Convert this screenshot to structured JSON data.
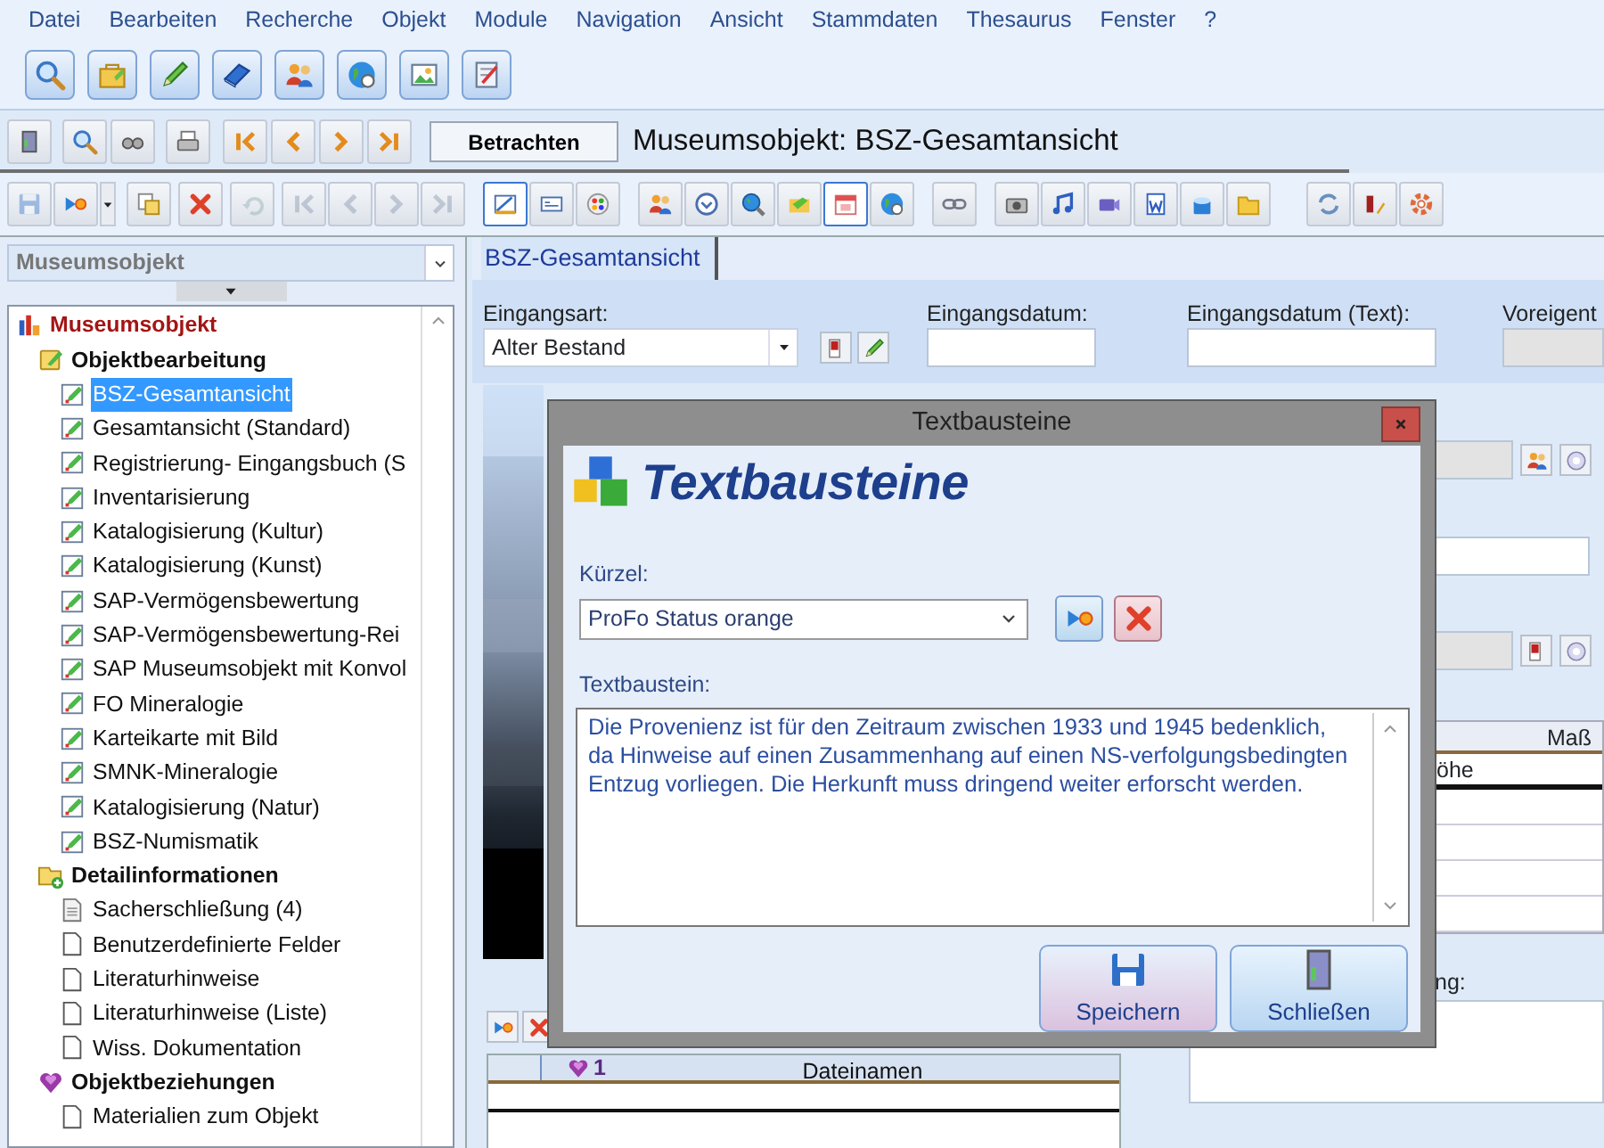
{
  "menu": [
    "Datei",
    "Bearbeiten",
    "Recherche",
    "Objekt",
    "Module",
    "Navigation",
    "Ansicht",
    "Stammdaten",
    "Thesaurus",
    "Fenster",
    "?"
  ],
  "record_bar": {
    "view_button": "Betrachten",
    "title": "Museumsobjekt: BSZ-Gesamtansicht"
  },
  "edit_toolbar": [
    {
      "on": false,
      "disabled": true
    },
    {
      "on": false,
      "disabled": false
    },
    {
      "on": false,
      "disabled": false
    },
    {
      "on": false,
      "disabled": false
    },
    {
      "on": false,
      "disabled": true
    },
    {
      "on": false,
      "disabled": true
    },
    {
      "on": false,
      "disabled": true
    },
    {
      "on": false,
      "disabled": true
    },
    {
      "on": false,
      "disabled": true
    },
    {
      "on": true,
      "disabled": false
    },
    {
      "on": false,
      "disabled": false
    },
    {
      "on": false,
      "disabled": false
    },
    {
      "on": false,
      "disabled": false
    },
    {
      "on": false,
      "disabled": false
    },
    {
      "on": false,
      "disabled": false
    },
    {
      "on": false,
      "disabled": false
    },
    {
      "on": true,
      "disabled": false
    },
    {
      "on": false,
      "disabled": false
    },
    {
      "on": false,
      "disabled": false
    },
    {
      "on": false,
      "disabled": false
    },
    {
      "on": false,
      "disabled": false
    },
    {
      "on": false,
      "disabled": false
    },
    {
      "on": false,
      "disabled": false
    },
    {
      "on": false,
      "disabled": false
    },
    {
      "on": false,
      "disabled": false
    },
    {
      "on": false,
      "disabled": false
    },
    {
      "on": false,
      "disabled": false
    },
    {
      "on": false,
      "disabled": false
    }
  ],
  "navigator": {
    "selector": "Museumsobjekt",
    "tree": {
      "label": "Museumsobjekt",
      "kind": "root",
      "children": [
        {
          "label": "Objektbearbeitung",
          "kind": "group",
          "children": [
            {
              "label": "BSZ-Gesamtansicht",
              "kind": "form",
              "selected": true
            },
            {
              "label": "Gesamtansicht (Standard)",
              "kind": "form",
              "selected": false
            },
            {
              "label": "Registrierung- Eingangsbuch (S",
              "kind": "form",
              "selected": false
            },
            {
              "label": "Inventarisierung",
              "kind": "form",
              "selected": false
            },
            {
              "label": "Katalogisierung (Kultur)",
              "kind": "form",
              "selected": false
            },
            {
              "label": "Katalogisierung (Kunst)",
              "kind": "form",
              "selected": false
            },
            {
              "label": "SAP-Vermögensbewertung",
              "kind": "form",
              "selected": false
            },
            {
              "label": "SAP-Vermögensbewertung-Rei",
              "kind": "form",
              "selected": false
            },
            {
              "label": "SAP Museumsobjekt mit Konvol",
              "kind": "form",
              "selected": false
            },
            {
              "label": "FO Mineralogie",
              "kind": "form",
              "selected": false
            },
            {
              "label": "Karteikarte mit Bild",
              "kind": "form",
              "selected": false
            },
            {
              "label": "SMNK-Mineralogie",
              "kind": "form",
              "selected": false
            },
            {
              "label": "Katalogisierung (Natur)",
              "kind": "form",
              "selected": false
            },
            {
              "label": "BSZ-Numismatik",
              "kind": "form",
              "selected": false
            }
          ]
        },
        {
          "label": "Detailinformationen",
          "kind": "group",
          "children": [
            {
              "label": "Sacherschließung (4)",
              "kind": "list",
              "selected": false
            },
            {
              "label": "Benutzerdefinierte Felder",
              "kind": "page",
              "selected": false
            },
            {
              "label": "Literaturhinweise",
              "kind": "page",
              "selected": false
            },
            {
              "label": "Literaturhinweise (Liste)",
              "kind": "page",
              "selected": false
            },
            {
              "label": "Wiss. Dokumentation",
              "kind": "page",
              "selected": false
            }
          ]
        },
        {
          "label": "Objektbeziehungen",
          "kind": "group",
          "children": [
            {
              "label": "Materialien zum Objekt",
              "kind": "page",
              "selected": false
            }
          ]
        }
      ]
    }
  },
  "tabs": [
    {
      "label": "BSZ-Gesamtansicht",
      "selected": true
    }
  ],
  "form": {
    "eingangsart": {
      "label": "Eingangsart:",
      "value": "Alter Bestand"
    },
    "eingangsdatum": {
      "label": "Eingangsdatum:"
    },
    "eingangsdatum_text": {
      "label": "Eingangsdatum (Text):"
    },
    "field_4": {
      "label": "Voreigent",
      "disabled": true
    }
  },
  "right_table": {
    "column_1": "Maß",
    "cell_1": "öhe"
  },
  "right_label": "ng:",
  "files_table": {
    "columns": [
      "1",
      "Dateinamen"
    ]
  },
  "dialog": {
    "title": "Textbausteine",
    "heading": "Textbausteine",
    "shortcut": {
      "label": "Kürzel:",
      "value": "ProFo Status orange"
    },
    "text": {
      "label": "Textbaustein:",
      "value": "Die Provenienz ist für den Zeitraum zwischen 1933 und 1945 bedenklich, da Hinweise auf einen Zusammenhang auf einen NS-verfolgungsbedingten Entzug vorliegen. Die Herkunft muss dringend weiter erforscht werden."
    },
    "buttons": [
      "Speichern",
      "Schließen"
    ]
  }
}
